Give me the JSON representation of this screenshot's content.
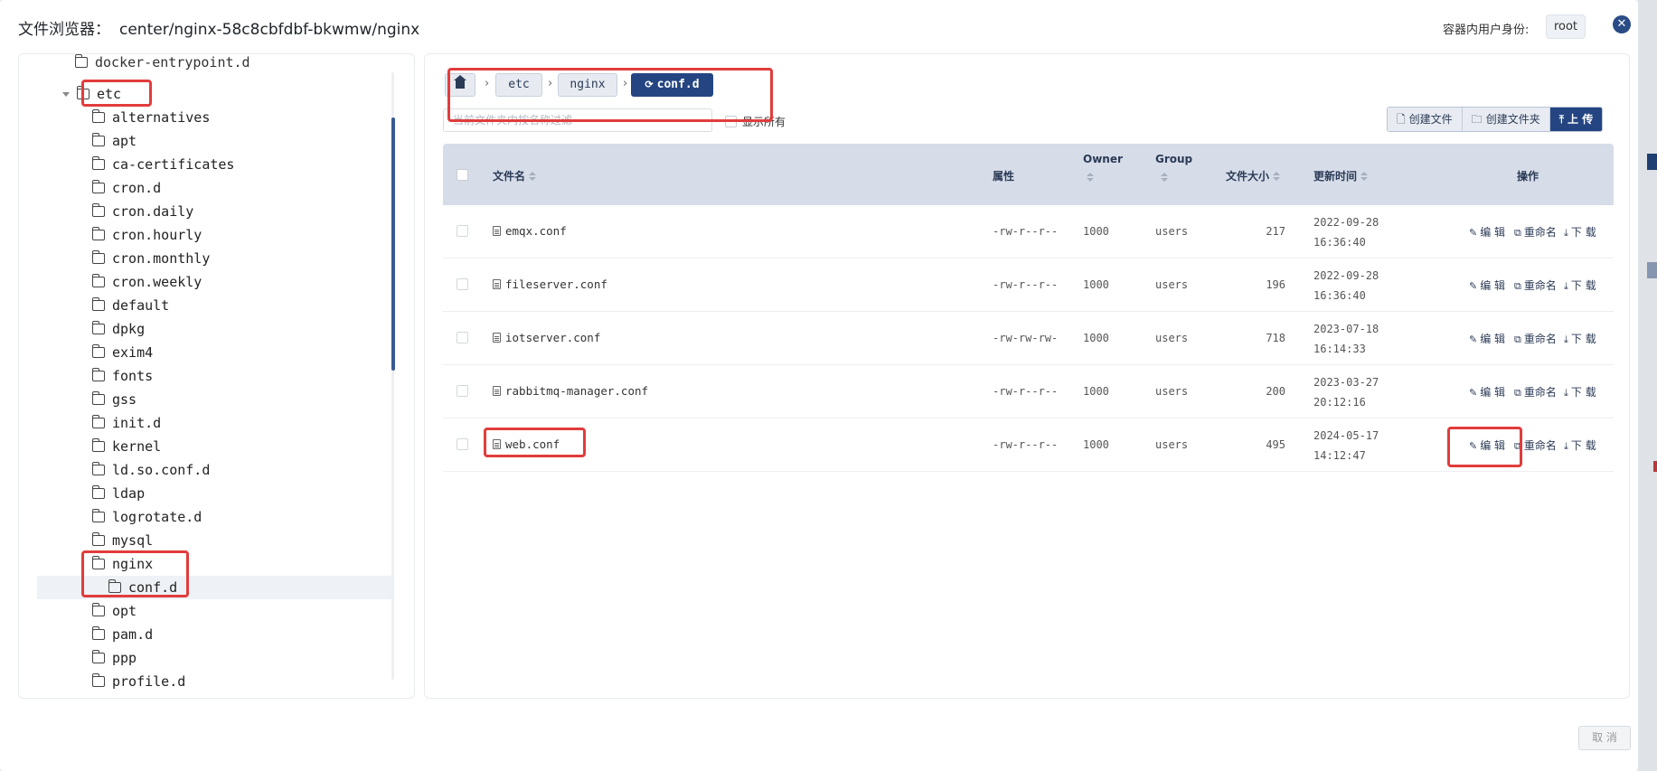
{
  "header": {
    "title": "文件浏览器：",
    "path": "center/nginx-58c8cbfdbf-bkwmw/nginx",
    "user_label": "容器内用户身份:",
    "user": "root"
  },
  "tree": {
    "partial_top": "docker-entrypoint.d",
    "root_item": "etc",
    "items": [
      "alternatives",
      "apt",
      "ca-certificates",
      "cron.d",
      "cron.daily",
      "cron.hourly",
      "cron.monthly",
      "cron.weekly",
      "default",
      "dpkg",
      "exim4",
      "fonts",
      "gss",
      "init.d",
      "kernel",
      "ld.so.conf.d",
      "ldap",
      "logrotate.d",
      "mysql",
      "nginx"
    ],
    "child": "conf.d",
    "items_after": [
      "opt",
      "pam.d",
      "ppp"
    ],
    "partial_bottom": "profile.d"
  },
  "breadcrumb": {
    "home_icon": "home-icon",
    "items": [
      "etc",
      "nginx"
    ],
    "current": "conf.d"
  },
  "filter": {
    "placeholder": "当前文件夹内按名称过滤",
    "show_all_label": "显示所有"
  },
  "actions": {
    "create_file": "创建文件",
    "create_folder": "创建文件夹",
    "upload": "上 传"
  },
  "table": {
    "headers": {
      "name": "文件名",
      "attr": "属性",
      "owner": "Owner",
      "group": "Group",
      "size": "文件大小",
      "mtime": "更新时间",
      "ops": "操作"
    },
    "op_labels": {
      "edit": "编 辑",
      "rename": "重命名",
      "download": "下 载"
    },
    "rows": [
      {
        "name": "emqx.conf",
        "perm": "-rw-r--r--",
        "owner": "1000",
        "group": "users",
        "size": "217",
        "mtime": "2022-09-28 16:36:40"
      },
      {
        "name": "fileserver.conf",
        "perm": "-rw-r--r--",
        "owner": "1000",
        "group": "users",
        "size": "196",
        "mtime": "2022-09-28 16:36:40"
      },
      {
        "name": "iotserver.conf",
        "perm": "-rw-rw-rw-",
        "owner": "1000",
        "group": "users",
        "size": "718",
        "mtime": "2023-07-18 16:14:33"
      },
      {
        "name": "rabbitmq-manager.conf",
        "perm": "-rw-r--r--",
        "owner": "1000",
        "group": "users",
        "size": "200",
        "mtime": "2023-03-27 20:12:16"
      },
      {
        "name": "web.conf",
        "perm": "-rw-r--r--",
        "owner": "1000",
        "group": "users",
        "size": "495",
        "mtime": "2024-05-17 14:12:47"
      }
    ]
  },
  "footer": {
    "cancel": "取 消"
  },
  "colors": {
    "primary": "#244582",
    "highlight": "#e23c3c",
    "header_bg": "#d6dde9"
  }
}
